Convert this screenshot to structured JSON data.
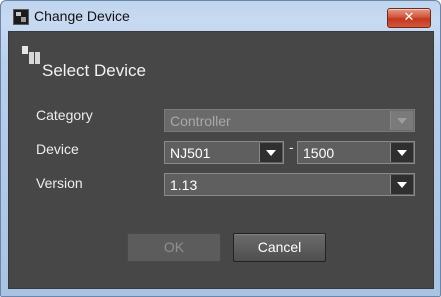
{
  "window": {
    "title": "Change Device",
    "close_label": "✕"
  },
  "header": {
    "title": "Select Device"
  },
  "form": {
    "category": {
      "label": "Category",
      "value": "Controller",
      "enabled": false
    },
    "device": {
      "label": "Device",
      "model": "NJ501",
      "separator": "-",
      "variant": "1500"
    },
    "version": {
      "label": "Version",
      "value": "1.13"
    }
  },
  "buttons": {
    "ok_label": "OK",
    "cancel_label": "Cancel"
  },
  "colors": {
    "dialog_background": "#474747",
    "frame": "#b9d0ec",
    "close_button": "#c7432a"
  }
}
